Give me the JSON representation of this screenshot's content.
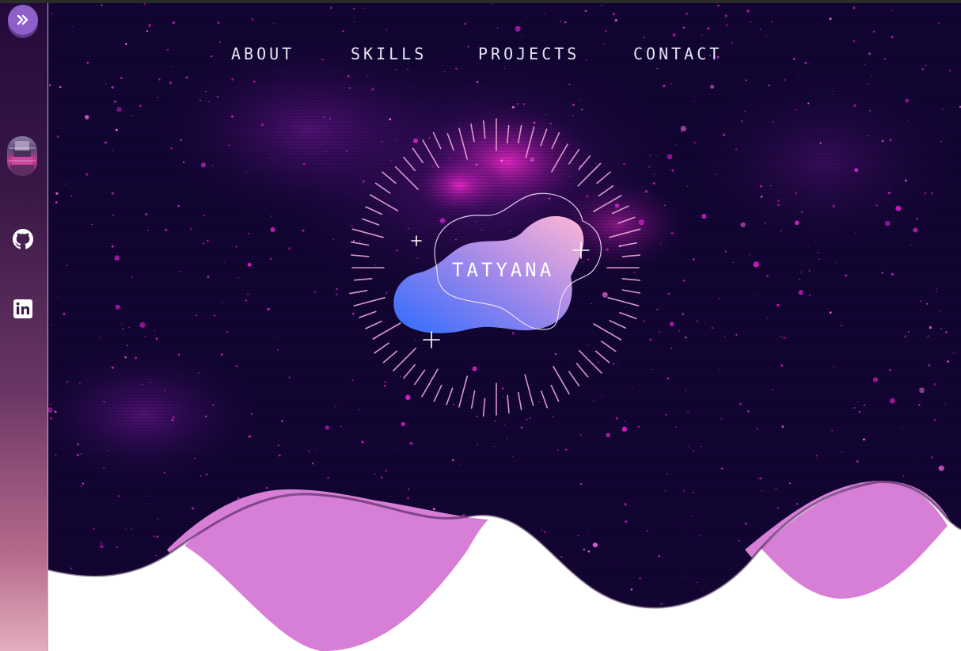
{
  "nav": {
    "items": [
      {
        "label": "ABOUT"
      },
      {
        "label": "SKILLS"
      },
      {
        "label": "PROJECTS"
      },
      {
        "label": "CONTACT"
      }
    ]
  },
  "hero": {
    "name": "TATYANA"
  },
  "sidebar": {
    "toggle_icon": "chevrons-right-icon",
    "social": [
      {
        "name": "github-icon"
      },
      {
        "name": "linkedin-icon"
      }
    ]
  },
  "colors": {
    "space_background": "#0f0430",
    "star_pink": "#e01fd0",
    "wave_pink": "#d77fd6",
    "blob_blue": "#3b6cff",
    "blob_pink": "#ffb0d8",
    "sidebar_top": "#230a3a",
    "sidebar_bottom": "#e3aebd",
    "toggle_button": "#8e5fc9"
  }
}
